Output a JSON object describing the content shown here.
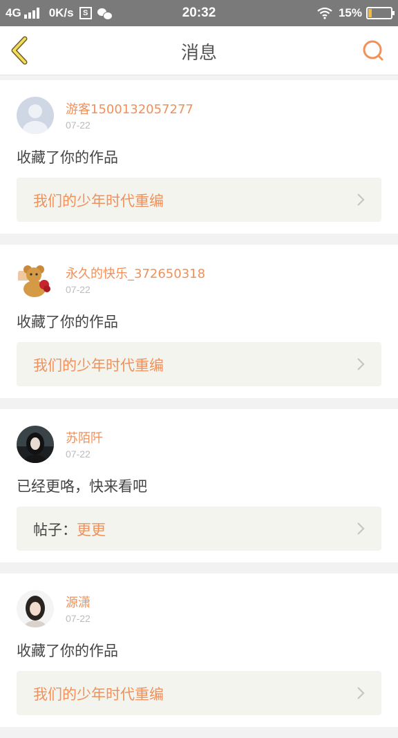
{
  "status_bar": {
    "network": "4G",
    "speed": "0K/s",
    "s_icon": "S",
    "time": "20:32",
    "battery": "15%",
    "battery_color": "#f2b93b"
  },
  "nav": {
    "title": "消息",
    "back_icon": "chevron-left-icon",
    "search_icon": "search-icon",
    "accent": "#f0905a"
  },
  "messages": [
    {
      "user": "游客1500132057277",
      "date": "07-22",
      "text": "收藏了你的作品",
      "link_prefix": "",
      "link_title": "我们的少年时代重编"
    },
    {
      "user": "永久的快乐_372650318",
      "date": "07-22",
      "text": "收藏了你的作品",
      "link_prefix": "",
      "link_title": "我们的少年时代重编"
    },
    {
      "user": "苏陌阡",
      "date": "07-22",
      "text": "已经更咯，快来看吧",
      "link_prefix": "帖子：",
      "link_title": "更更"
    },
    {
      "user": "源潇",
      "date": "07-22",
      "text": "收藏了你的作品",
      "link_prefix": "",
      "link_title": "我们的少年时代重编"
    }
  ]
}
